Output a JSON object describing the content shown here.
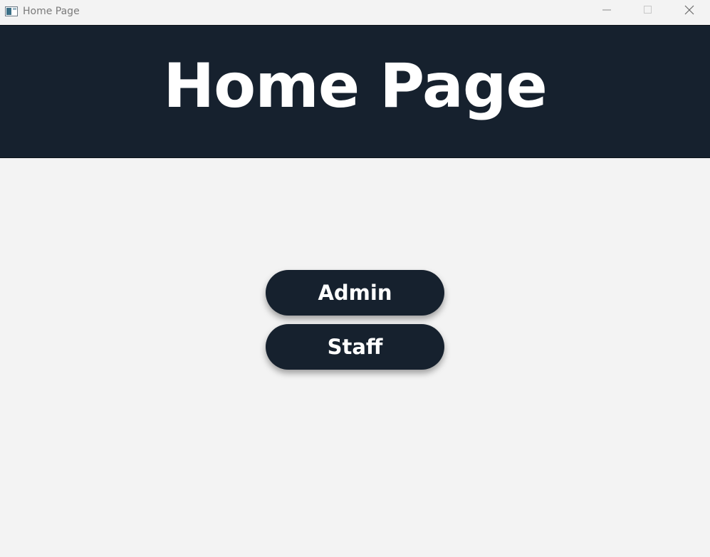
{
  "window": {
    "title": "Home Page"
  },
  "header": {
    "title": "Home Page",
    "background": "#16212e",
    "text_color": "#ffffff"
  },
  "buttons": {
    "admin_label": "Admin",
    "staff_label": "Staff"
  },
  "icons": {
    "app": "app-window-icon",
    "minimize": "minimize-icon",
    "maximize": "maximize-icon",
    "close": "close-icon"
  }
}
